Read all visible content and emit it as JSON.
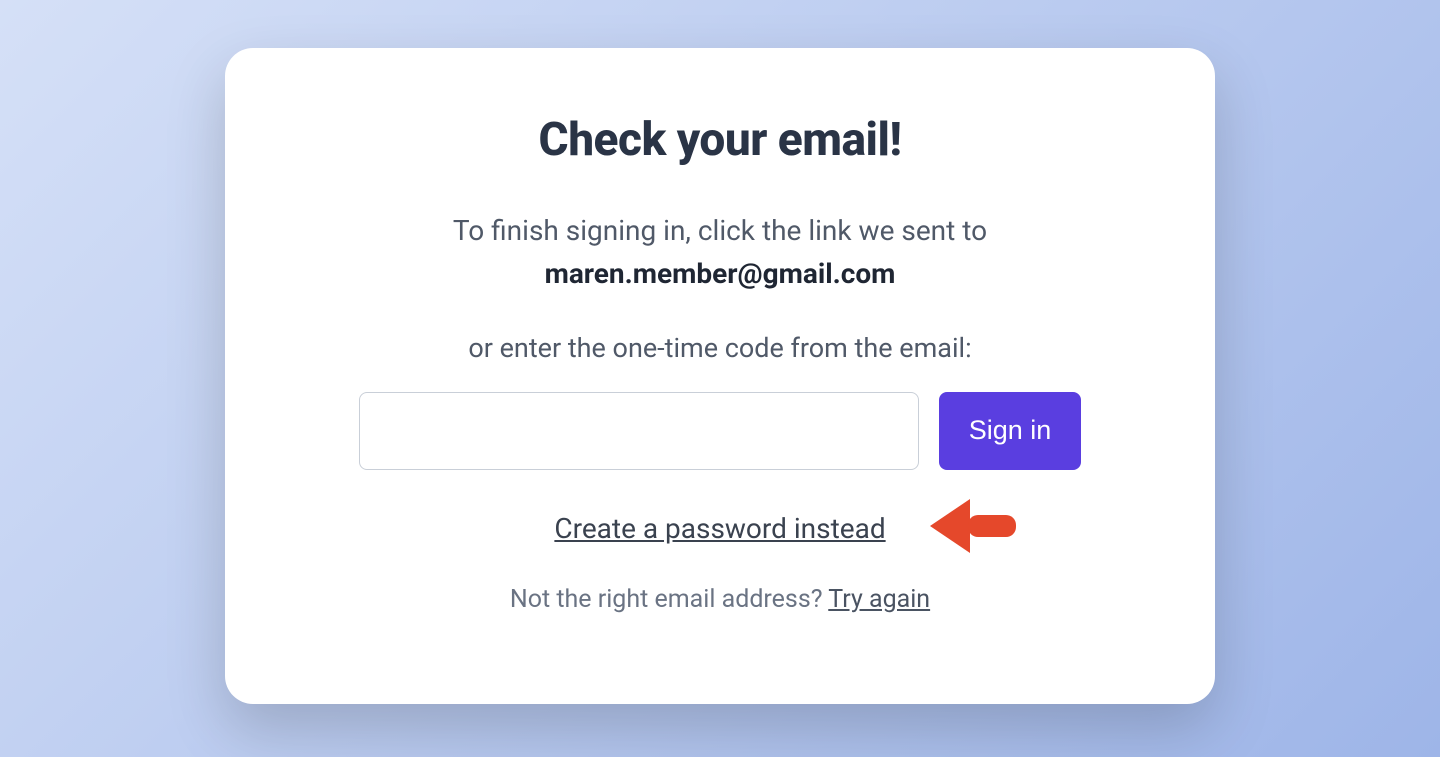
{
  "card": {
    "title": "Check your email!",
    "instruction_prefix": "To finish signing in, click the link we sent to",
    "email": "maren.member@gmail.com",
    "code_prompt": "or enter the one-time code from the email:",
    "code_value": "",
    "signin_label": "Sign in",
    "create_password_link": "Create a password instead",
    "wrong_email_prefix": "Not the right email address? ",
    "try_again_link": "Try again"
  },
  "colors": {
    "accent": "#5a3ee0",
    "arrow": "#e5482b"
  }
}
